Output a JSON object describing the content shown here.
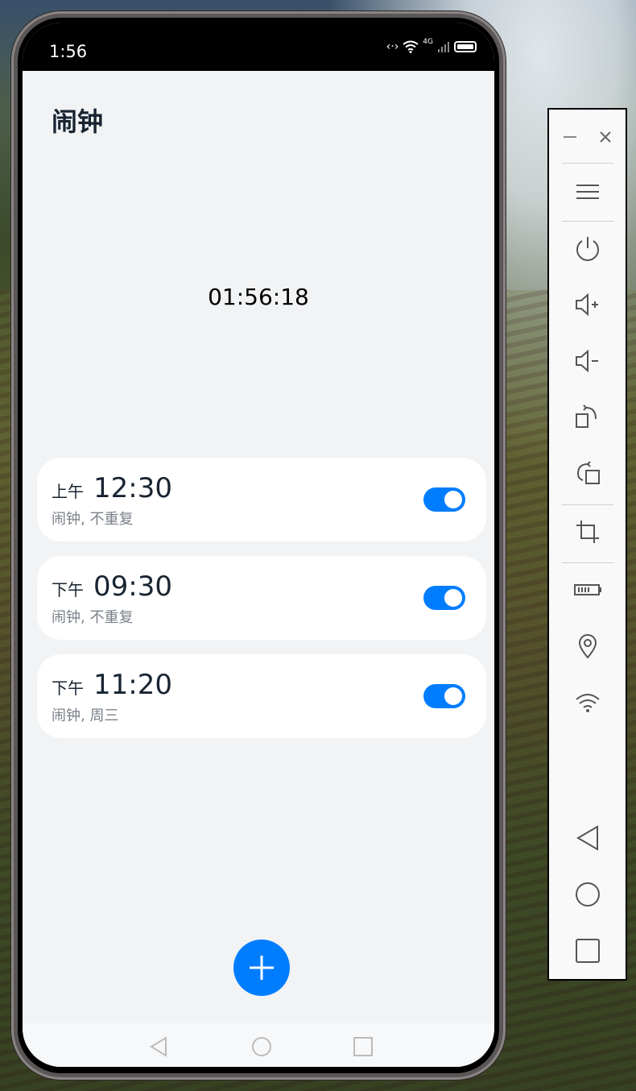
{
  "status_bar": {
    "time": "1:56",
    "network": "4G"
  },
  "app": {
    "title": "闹钟"
  },
  "current_time": "01:56:18",
  "alarms": [
    {
      "period": "上午",
      "time": "12:30",
      "desc": "闹钟, 不重复",
      "enabled": true
    },
    {
      "period": "下午",
      "time": "09:30",
      "desc": "闹钟, 不重复",
      "enabled": true
    },
    {
      "period": "下午",
      "time": "11:20",
      "desc": "闹钟, 周三",
      "enabled": true
    }
  ],
  "colors": {
    "accent": "#007dff",
    "background": "#f1f3f5",
    "card": "#ffffff",
    "text": "#182431",
    "subtext": "#7a818a"
  },
  "icons": {
    "fab": "plus-icon",
    "nav": [
      "back-icon",
      "home-icon",
      "recents-icon"
    ],
    "toolbar": [
      "minimize-icon",
      "close-icon",
      "menu-icon",
      "power-icon",
      "volume-up-icon",
      "volume-down-icon",
      "rotate-right-icon",
      "rotate-left-icon",
      "crop-icon",
      "battery-icon",
      "location-icon",
      "wifi-icon",
      "back-icon",
      "home-icon",
      "recents-icon"
    ]
  }
}
